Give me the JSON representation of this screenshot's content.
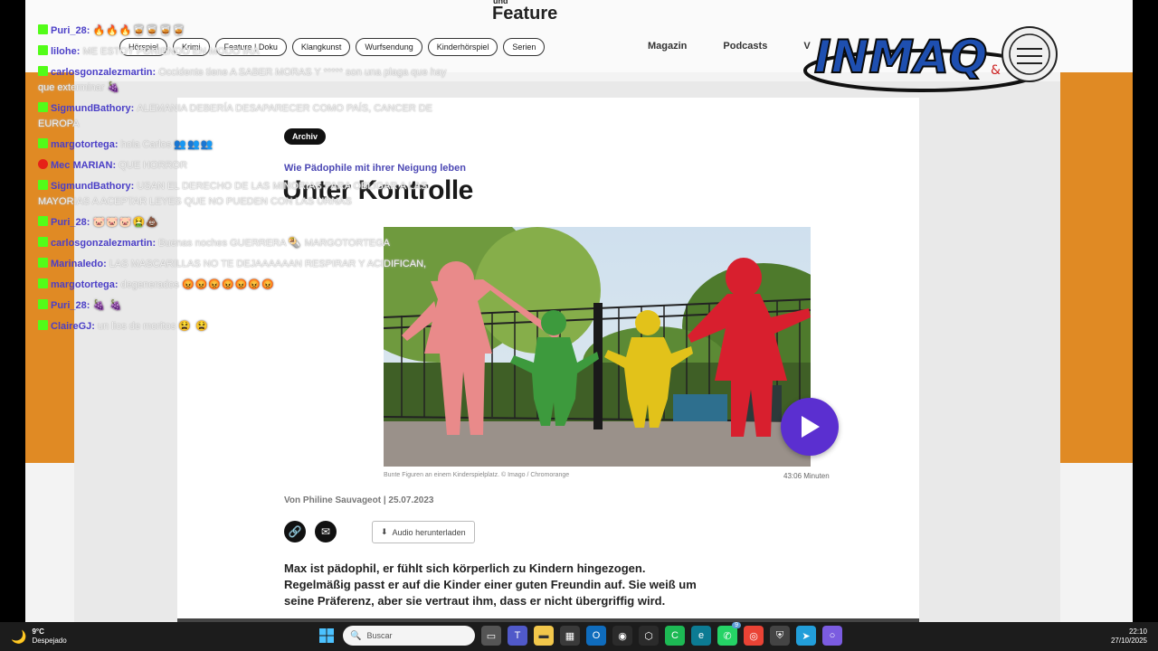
{
  "site": {
    "brand_small": "und",
    "brand": "Feature",
    "category_chips": [
      "Hörspiel",
      "Krimi",
      "Feature | Doku",
      "Klangkunst",
      "Wurfsendung",
      "Kinderhörspiel",
      "Serien"
    ],
    "nav_links": [
      "Magazin",
      "Podcasts",
      "V"
    ]
  },
  "article": {
    "tag": "Archiv",
    "kicker": "Wie Pädophile mit ihrer Neigung leben",
    "headline": "Unter Kontrolle",
    "caption": "Bunte Figuren an einem Kinderspielplatz. © Imago / Chromorange",
    "duration": "43:06 Minuten",
    "byline": "Von Philine Sauvageot | 25.07.2023",
    "download_label": "Audio herunterladen",
    "body": [
      "Max ist pädophil, er fühlt sich körperlich zu Kindern hingezogen.",
      "Regelmäßig passt er auf die Kinder einer guten Freundin auf. Sie weiß um",
      "seine Präferenz, aber sie vertraut ihm, dass er nicht übergriffig wird."
    ]
  },
  "logo_text": "INMAQ",
  "chat": [
    {
      "user": "Puri_28",
      "text": "",
      "emotes": "🔥🔥🔥🥃🥃🥃🥃",
      "badge": "green"
    },
    {
      "user": "lilohe",
      "text": "ME ESTOY PONIENDO EN MODO IRA",
      "emotes": "",
      "badge": "green"
    },
    {
      "user": "carlosgonzalezmartin",
      "text": "Occidente tiene A SABER MORAS Y ***** son una plaga que hay que exterminar",
      "emotes": "🍇",
      "badge": "green"
    },
    {
      "user": "SigmundBathory",
      "text": "ALEMANIA DEBERÍA DESAPARECER COMO PAÍS, CANCER DE EUROPA",
      "emotes": "",
      "badge": "green"
    },
    {
      "user": "margotortega",
      "text": "hola Carlos",
      "emotes": "👥👥👥",
      "badge": "green"
    },
    {
      "user": "Mec MARIAN",
      "text": "QUE HORROR",
      "emotes": "",
      "badge": "red"
    },
    {
      "user": "SigmundBathory",
      "text": "USAN EL DERECHO DE LAS MINORIAS PARA OBLIGAR A LAS MAYORIAS A ACEPTAR LEYES QUE NO PUEDEN CON LAS URNAS",
      "emotes": "",
      "badge": "green"
    },
    {
      "user": "Puri_28",
      "text": "",
      "emotes": "🐷🐷🐷🤮💩",
      "badge": "green"
    },
    {
      "user": "carlosgonzalezmartin",
      "text": "Buenas noches GUERRERA",
      "emotes": "🌯",
      "text2": "MARGOTORTEGA",
      "badge": "green"
    },
    {
      "user": "Marinaledo",
      "text": "LAS MASCARILLAS NO TE DEJAAAAAAN RESPIRAR Y ACIDIFICAN,",
      "emotes": "",
      "badge": "green"
    },
    {
      "user": "margotortega",
      "text": "degenerados",
      "emotes": "😡😡😡😡😡😡😡",
      "badge": "green"
    },
    {
      "user": "Puri_28",
      "text": "",
      "emotes": "🍇 🍇",
      "badge": "green"
    },
    {
      "user": "ClaireGJ",
      "text": "un lios de moritos",
      "emotes": "😫 😫",
      "badge": "green"
    }
  ],
  "taskbar": {
    "temp": "9°C",
    "weather": "Despejado",
    "search_placeholder": "Buscar",
    "time": "22:10",
    "date": "27/10/2025",
    "badge_count": "9"
  }
}
